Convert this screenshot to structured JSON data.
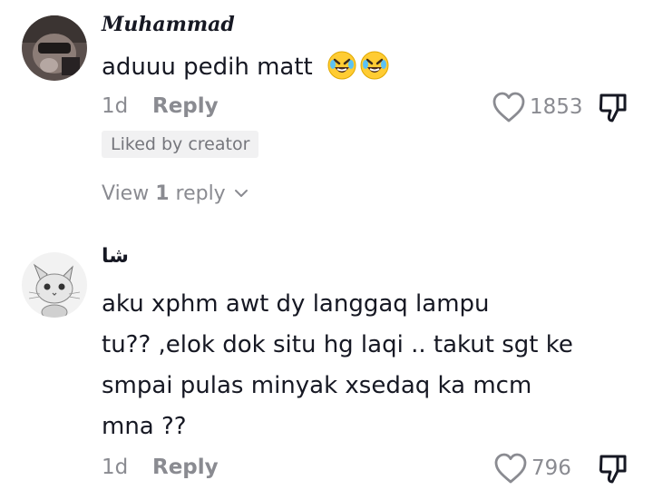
{
  "comments": [
    {
      "username": "Muhammad",
      "text": "aduuu pedih matt",
      "emoji_icons": [
        "rolling-on-floor-laughing-icon",
        "rolling-on-floor-laughing-icon"
      ],
      "age": "1d",
      "reply_label": "Reply",
      "likes": "1853",
      "badge": "Liked by creator",
      "view_replies": {
        "prefix": "View ",
        "count": "1",
        "suffix": " reply"
      }
    },
    {
      "username": "شا",
      "text_lines": [
        "aku xphm awt dy langgaq lampu",
        "tu?? ,elok dok situ hg laqi .. takut sgt ke",
        "smpai pulas minyak xsedaq ka mcm",
        "mna ??"
      ],
      "age": "1d",
      "reply_label": "Reply",
      "likes": "796"
    }
  ],
  "colors": {
    "text_primary": "#161823",
    "text_secondary": "#8a8b91",
    "badge_bg": "#f1f1f2",
    "emoji_yellow": "#ffcc33"
  }
}
